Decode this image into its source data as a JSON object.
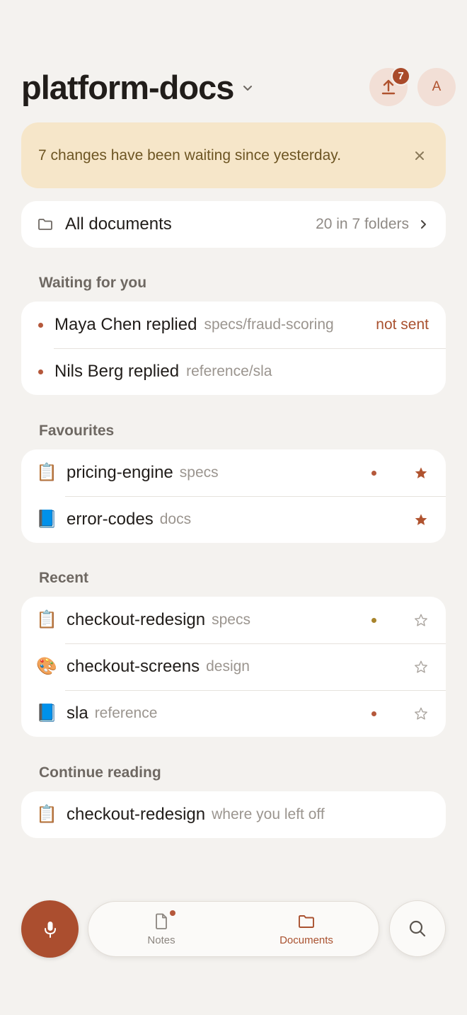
{
  "header": {
    "title": "platform-docs",
    "upload_badge": "7",
    "avatar_initial": "A"
  },
  "banner": {
    "text": "7 changes have been waiting since yesterday."
  },
  "all_documents": {
    "label": "All documents",
    "meta": "20 in 7 folders"
  },
  "waiting": {
    "label": "Waiting for you",
    "items": [
      {
        "who": "Maya Chen replied",
        "path": "specs/fraud-scoring",
        "status": "not sent"
      },
      {
        "who": "Nils Berg replied",
        "path": "reference/sla",
        "status": ""
      }
    ]
  },
  "favourites": {
    "label": "Favourites",
    "items": [
      {
        "icon": "clipboard-icon",
        "glyph": "📋",
        "name": "pricing-engine",
        "folder": "specs",
        "dot": "red",
        "starred": true
      },
      {
        "icon": "blue-book-icon",
        "glyph": "📘",
        "name": "error-codes",
        "folder": "docs",
        "dot": "",
        "starred": true
      }
    ]
  },
  "recent": {
    "label": "Recent",
    "items": [
      {
        "icon": "clipboard-icon",
        "glyph": "📋",
        "name": "checkout-redesign",
        "folder": "specs",
        "dot": "amber",
        "starred": false
      },
      {
        "icon": "palette-icon",
        "glyph": "🎨",
        "name": "checkout-screens",
        "folder": "design",
        "dot": "",
        "starred": false
      },
      {
        "icon": "blue-book-icon",
        "glyph": "📘",
        "name": "sla",
        "folder": "reference",
        "dot": "red",
        "starred": false
      }
    ]
  },
  "continue_reading": {
    "label": "Continue reading",
    "item": {
      "icon": "clipboard-icon",
      "glyph": "📋",
      "name": "checkout-redesign",
      "hint": "where you left off"
    }
  },
  "tabs": {
    "notes": "Notes",
    "documents": "Documents"
  },
  "colors": {
    "accent": "#ab4e2f",
    "background": "#f4f2ef",
    "banner_bg": "#f6e6c9",
    "banner_text": "#6d5523",
    "dot_red": "#b5583b",
    "dot_amber": "#a8842c"
  }
}
